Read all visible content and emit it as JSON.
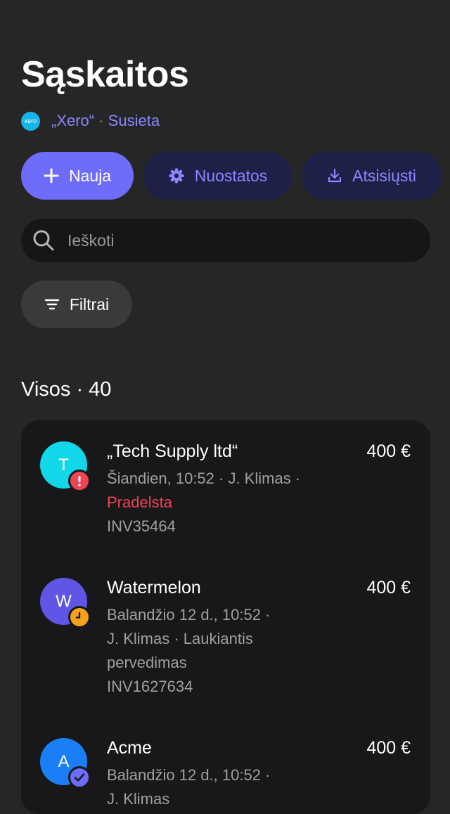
{
  "header": {
    "title": "Sąskaitos"
  },
  "integration": {
    "logo_text": "xero",
    "status_text": "„Xero“ · Susieta"
  },
  "actions": {
    "new_label": "Nauja",
    "settings_label": "Nuostatos",
    "download_label": "Atsisiųsti"
  },
  "search": {
    "placeholder": "Ieškoti",
    "value": ""
  },
  "filters": {
    "label": "Filtrai"
  },
  "list": {
    "heading": "Visos · 40",
    "items": [
      {
        "initial": "T",
        "avatar_color": "#11d7e8",
        "status_icon": "alert-icon",
        "status_color": "#ef4455",
        "name": "„Tech Supply ltd“",
        "amount": "400 €",
        "meta": "Šiandien, 10:52 · J. Klimas ·",
        "status": "Pradelsta",
        "invoice": "INV35464"
      },
      {
        "initial": "W",
        "avatar_color": "#5f56e6",
        "status_icon": "clock-icon",
        "status_color": "#f5a21b",
        "name": "Watermelon",
        "amount": "400 €",
        "meta": "Balandžio 12 d., 10:52 ·",
        "meta2": "J. Klimas · Laukiantis",
        "meta3": "pervedimas",
        "invoice": "INV1627634"
      },
      {
        "initial": "A",
        "avatar_color": "#1a7ff5",
        "status_icon": "check-icon",
        "status_color": "#6e6dfb",
        "name": "Acme",
        "amount": "400 €",
        "meta": "Balandžio 12 d., 10:52 ·",
        "meta2": "J. Klimas"
      }
    ]
  },
  "colors": {
    "background": "#262626",
    "accent": "#6e6dfb",
    "accent_text": "#8a87ff",
    "secondary_button": "#1e2048",
    "overdue": "#ef4455"
  }
}
